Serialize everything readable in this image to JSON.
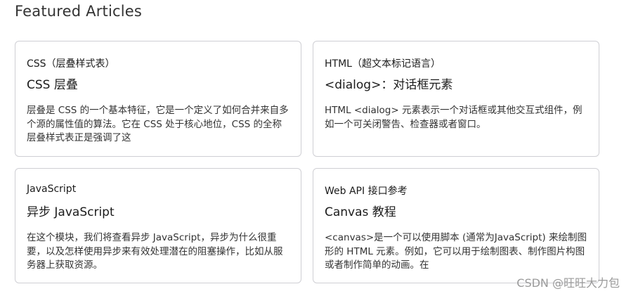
{
  "section": {
    "title": "Featured Articles"
  },
  "cards": [
    {
      "category": "CSS（层叠样式表）",
      "title": "CSS 层叠",
      "description": "层叠是 CSS 的一个基本特征，它是一个定义了如何合并来自多个源的属性值的算法。它在 CSS 处于核心地位，CSS 的全称层叠样式表正是强调了这"
    },
    {
      "category": "HTML（超文本标记语言）",
      "title": "<dialog>：对话框元素",
      "description": "HTML <dialog> 元素表示一个对话框或其他交互式组件，例如一个可关闭警告、检查器或者窗口。"
    },
    {
      "category": "JavaScript",
      "title": "异步 JavaScript",
      "description": "在这个模块，我们将查看异步 JavaScript，异步为什么很重要，以及怎样使用异步来有效处理潜在的阻塞操作，比如从服务器上获取资源。"
    },
    {
      "category": "Web API 接口参考",
      "title": "Canvas 教程",
      "description": "<canvas>是一个可以使用脚本 (通常为JavaScript) 来绘制图形的 HTML 元素。例如，它可以用于绘制图表、制作图片构图或者制作简单的动画。在"
    }
  ],
  "watermark": "CSDN @旺旺大力包"
}
